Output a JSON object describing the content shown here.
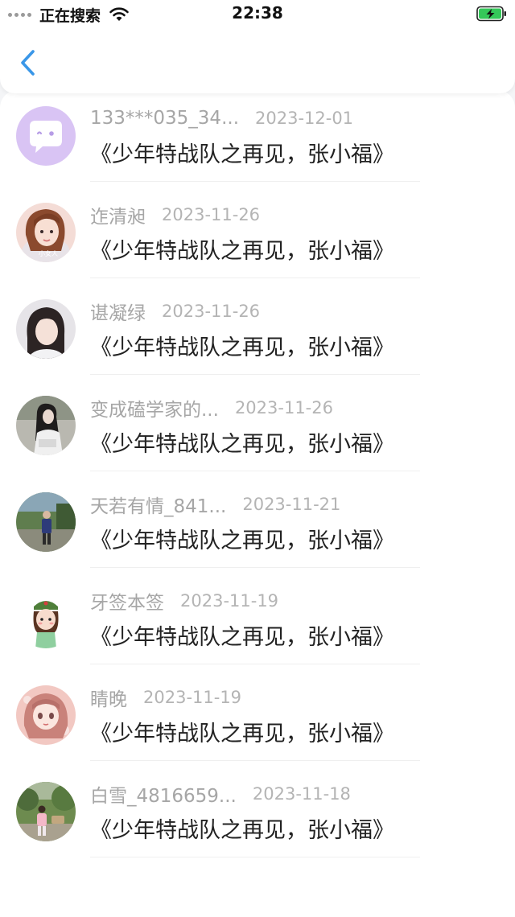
{
  "status_bar": {
    "carrier": "正在搜索",
    "time": "22:38",
    "signal_icon": "signal-dots-icon",
    "wifi_icon": "wifi-icon",
    "battery_icon": "battery-charging-icon"
  },
  "nav": {
    "back_icon": "chevron-left-icon"
  },
  "colors": {
    "accent": "#3a97e8",
    "battery": "#34c759",
    "name_gray": "#a6a6a6",
    "date_gray": "#b4b4b4",
    "text": "#222222",
    "bot_avatar": "#d7c2f3"
  },
  "comments": [
    {
      "name": "",
      "date": "",
      "text": "《少年特战队之再见，张小福》",
      "avatar": "bot"
    },
    {
      "name": "133***035_34...",
      "date": "2023-12-01",
      "text": "《少年特战队之再见，张小福》",
      "avatar": "bot"
    },
    {
      "name": "迮清昶",
      "date": "2023-11-26",
      "text": "《少年特战队之再见，张小福》",
      "avatar": "girl1",
      "avatar_caption": "小女人"
    },
    {
      "name": "谌凝绿",
      "date": "2023-11-26",
      "text": "《少年特战队之再见，张小福》",
      "avatar": "girl2"
    },
    {
      "name": "变成磕学家的...",
      "date": "2023-11-26",
      "text": "《少年特战队之再见，张小福》",
      "avatar": "girl3"
    },
    {
      "name": "天若有情_841...",
      "date": "2023-11-21",
      "text": "《少年特战队之再见，张小福》",
      "avatar": "outdoor"
    },
    {
      "name": "牙签本签",
      "date": "2023-11-19",
      "text": "《少年特战队之再见，张小福》",
      "avatar": "cartoon"
    },
    {
      "name": "睛晚",
      "date": "2023-11-19",
      "text": "《少年特战队之再见，张小福》",
      "avatar": "anime"
    },
    {
      "name": "白雪_4816659...",
      "date": "2023-11-18",
      "text": "《少年特战队之再见，张小福》",
      "avatar": "park"
    }
  ]
}
